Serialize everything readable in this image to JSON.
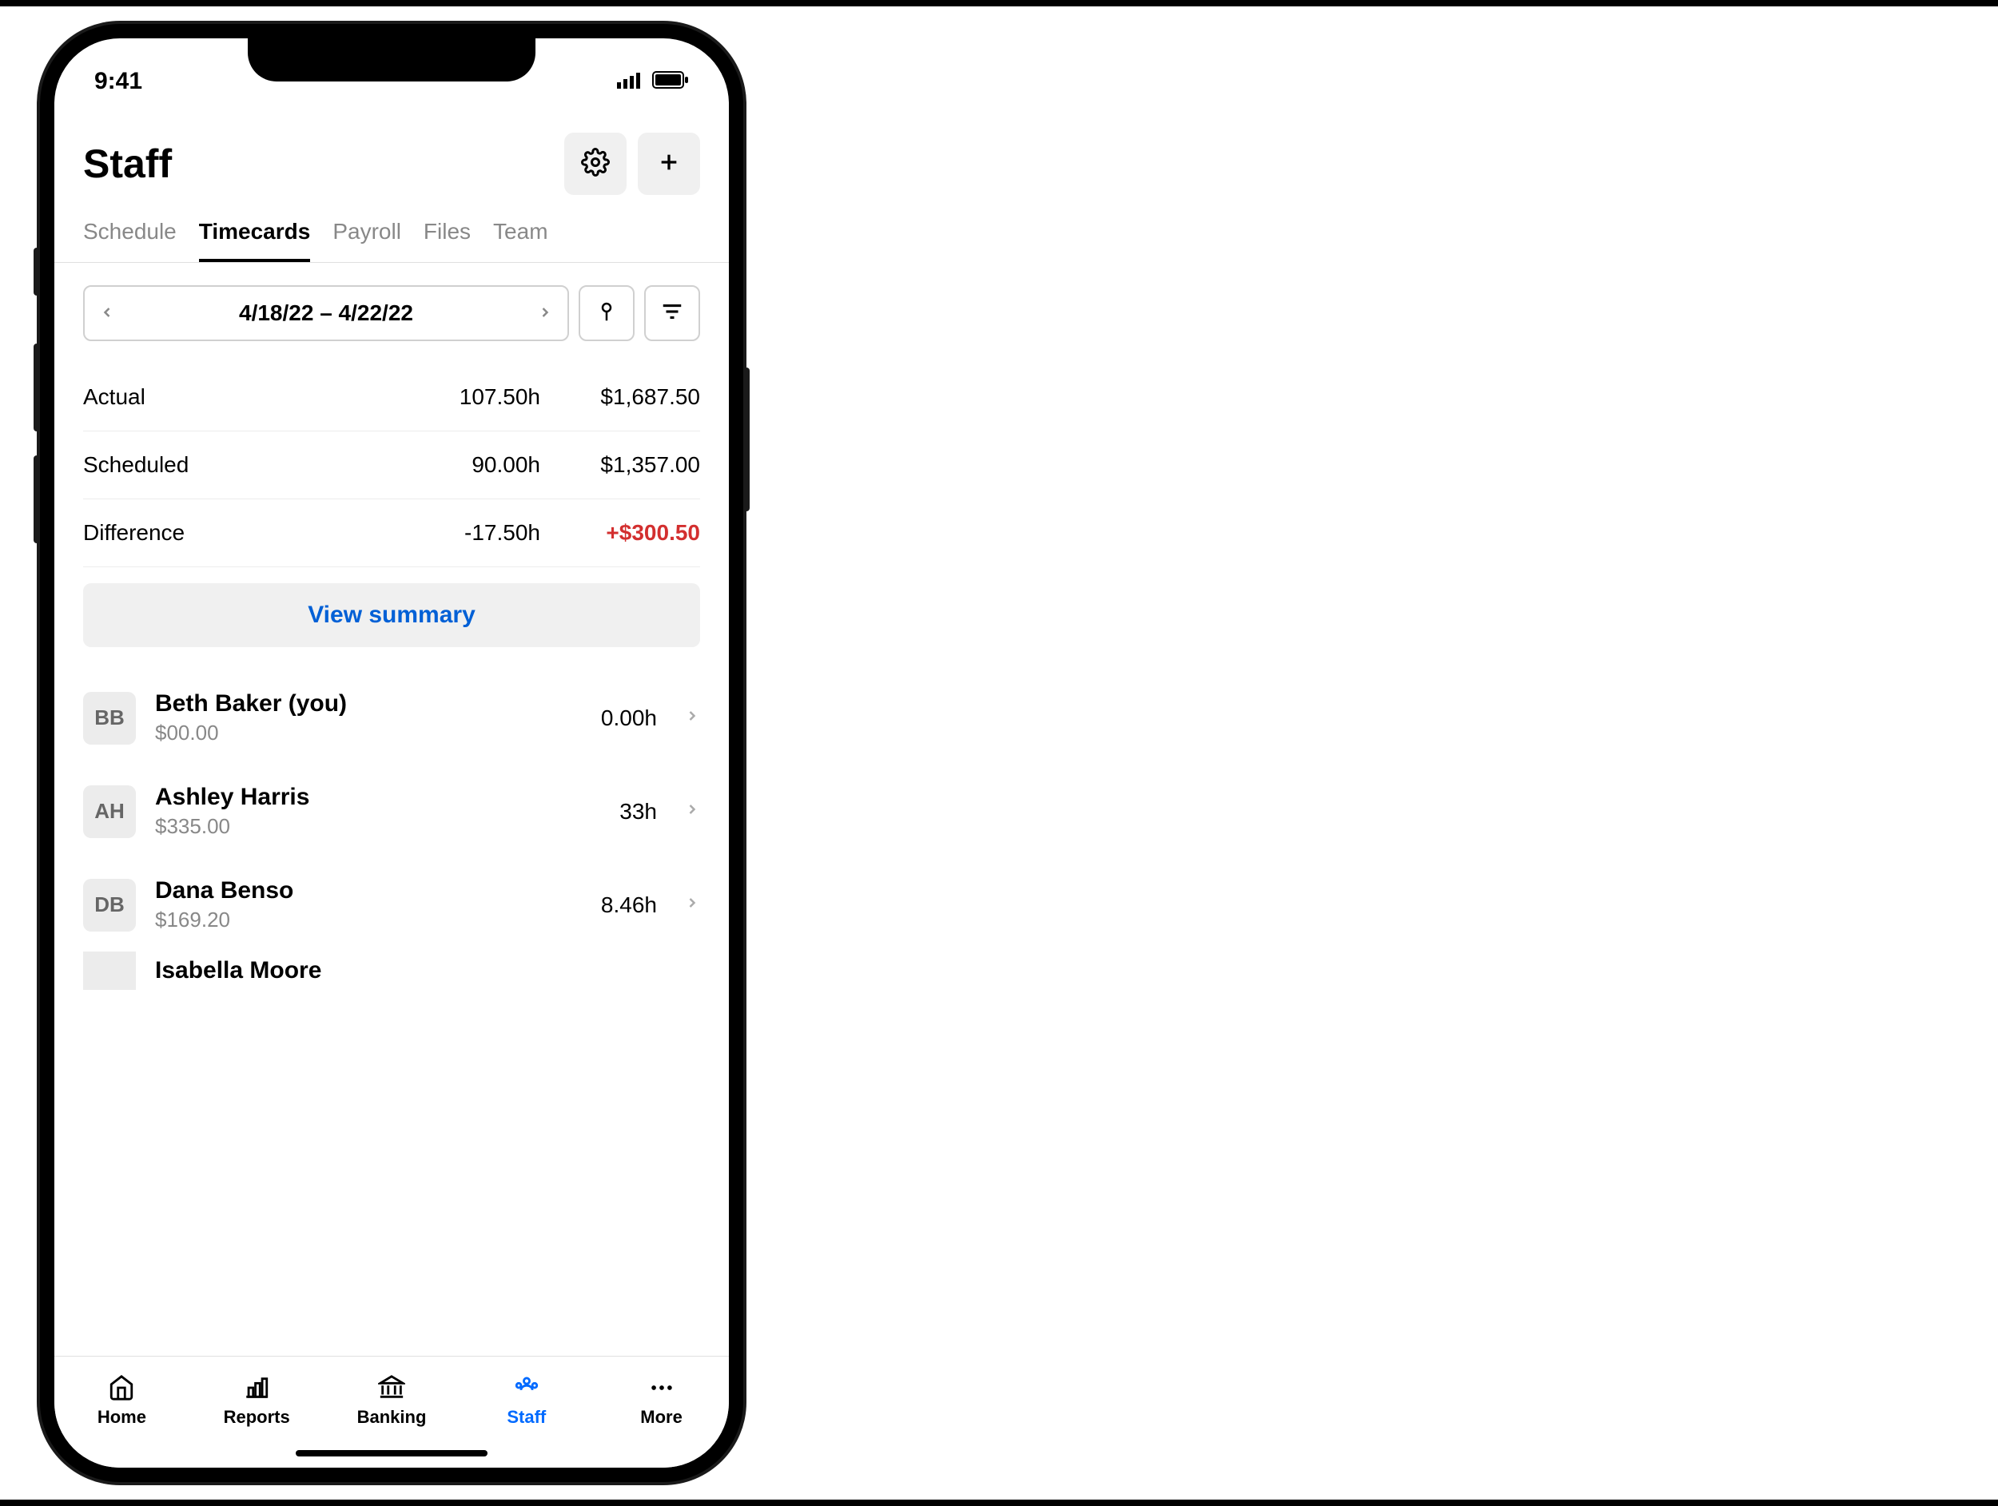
{
  "status": {
    "time": "9:41"
  },
  "header": {
    "title": "Staff"
  },
  "tabs": [
    {
      "label": "Schedule",
      "active": false
    },
    {
      "label": "Timecards",
      "active": true
    },
    {
      "label": "Payroll",
      "active": false
    },
    {
      "label": "Files",
      "active": false
    },
    {
      "label": "Team",
      "active": false
    }
  ],
  "date_range": "4/18/22 – 4/22/22",
  "summary": {
    "actual": {
      "label": "Actual",
      "hours": "107.50h",
      "amount": "$1,687.50"
    },
    "scheduled": {
      "label": "Scheduled",
      "hours": "90.00h",
      "amount": "$1,357.00"
    },
    "difference": {
      "label": "Difference",
      "hours": "-17.50h",
      "amount": "+$300.50"
    }
  },
  "view_summary_label": "View summary",
  "staff": [
    {
      "initials": "BB",
      "name": "Beth Baker (you)",
      "amount": "$00.00",
      "hours": "0.00h"
    },
    {
      "initials": "AH",
      "name": "Ashley Harris",
      "amount": "$335.00",
      "hours": "33h"
    },
    {
      "initials": "DB",
      "name": "Dana Benso",
      "amount": "$169.20",
      "hours": "8.46h"
    },
    {
      "initials": "",
      "name": "Isabella Moore",
      "amount": "",
      "hours": ""
    }
  ],
  "nav": [
    {
      "label": "Home"
    },
    {
      "label": "Reports"
    },
    {
      "label": "Banking"
    },
    {
      "label": "Staff"
    },
    {
      "label": "More"
    }
  ]
}
